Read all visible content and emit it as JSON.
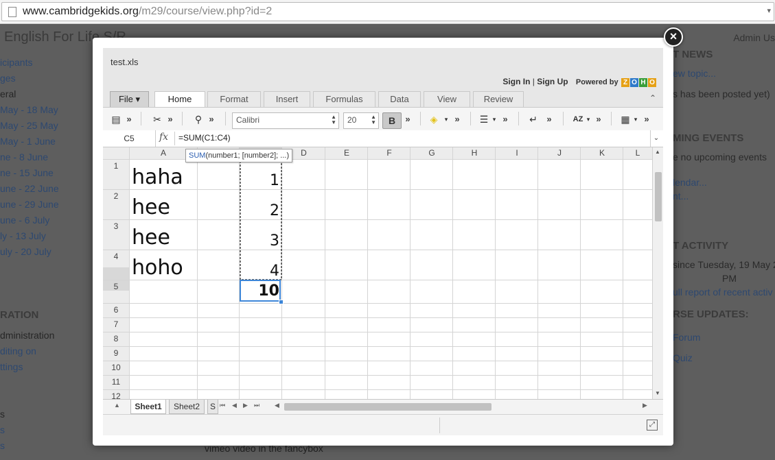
{
  "browser": {
    "url_host": "www.cambridgekids.org",
    "url_path": "/m29/course/view.php?id=2"
  },
  "background": {
    "course_title": "English For Life S/R",
    "admin_label": "Admin Us",
    "left_items": [
      "icipants",
      "ges",
      "eral",
      "May - 18 May",
      "May - 25 May",
      "May - 1 June",
      "ne - 8 June",
      "ne - 15 June",
      "une - 22 June",
      "une - 29 June",
      "une - 6 July",
      "ly - 13 July",
      "uly - 20 July"
    ],
    "left_heading": "RATION",
    "left_admin_items": [
      "dministration",
      "diting on",
      "ttings"
    ],
    "left_bottom": [
      "s",
      "s",
      "s"
    ],
    "right_news_heading": "T NEWS",
    "right_news_items": [
      "ew topic...",
      "s has been posted yet)"
    ],
    "right_events_heading": "MING EVENTS",
    "right_events_items": [
      "e no upcoming events",
      "lendar...",
      "nt..."
    ],
    "right_activity_heading": "T ACTIVITY",
    "right_activity_items": [
      "since Tuesday, 19 May 2",
      "PM",
      "ull report of recent activ"
    ],
    "right_updates_heading": "RSE UPDATES:",
    "right_updates_items": [
      "Forum",
      "Quiz"
    ],
    "footer_text": "vimeo video in the fancybox"
  },
  "modal": {
    "close_label": "×"
  },
  "app": {
    "filename": "test.xls",
    "sign_in": "Sign In",
    "divider": "|",
    "sign_up": "Sign Up",
    "powered_by": "Powered by",
    "logo_letters": [
      "Z",
      "O",
      "H",
      "O"
    ],
    "logo_colors": [
      "#e6a117",
      "#2f7ac9",
      "#3a9e3a",
      "#e6a117"
    ],
    "tabs": [
      {
        "label": "File ▾",
        "active": false
      },
      {
        "label": "Home",
        "active": true
      },
      {
        "label": "Format",
        "active": false
      },
      {
        "label": "Insert",
        "active": false
      },
      {
        "label": "Formulas",
        "active": false
      },
      {
        "label": "Data",
        "active": false
      },
      {
        "label": "View",
        "active": false
      },
      {
        "label": "Review",
        "active": false
      }
    ],
    "toolbar": {
      "font_name": "Calibri",
      "font_size": "20",
      "bold_label": "B",
      "more": "»",
      "sort_label": "AZ"
    },
    "formula_bar": {
      "cell_ref": "C5",
      "fx": "fx",
      "formula": "=SUM(C1:C4)"
    },
    "tooltip": {
      "fn": "SUM",
      "args": "(number1; [number2]; ...)"
    },
    "columns": [
      "A",
      "B",
      "C",
      "D",
      "E",
      "F",
      "G",
      "H",
      "I",
      "J",
      "K",
      "L"
    ],
    "rows": [
      "1",
      "2",
      "3",
      "4",
      "5",
      "6",
      "7",
      "8",
      "9",
      "10",
      "11",
      "12"
    ],
    "cells": {
      "a1": "haha",
      "a2": "hee",
      "a3": "hee",
      "a4": "hoho",
      "c1": "1",
      "c2": "2",
      "c3": "3",
      "c4": "4",
      "c5": "10"
    },
    "sheets": [
      "Sheet1",
      "Sheet2",
      "S"
    ],
    "accent_color": "#3d86d8"
  }
}
